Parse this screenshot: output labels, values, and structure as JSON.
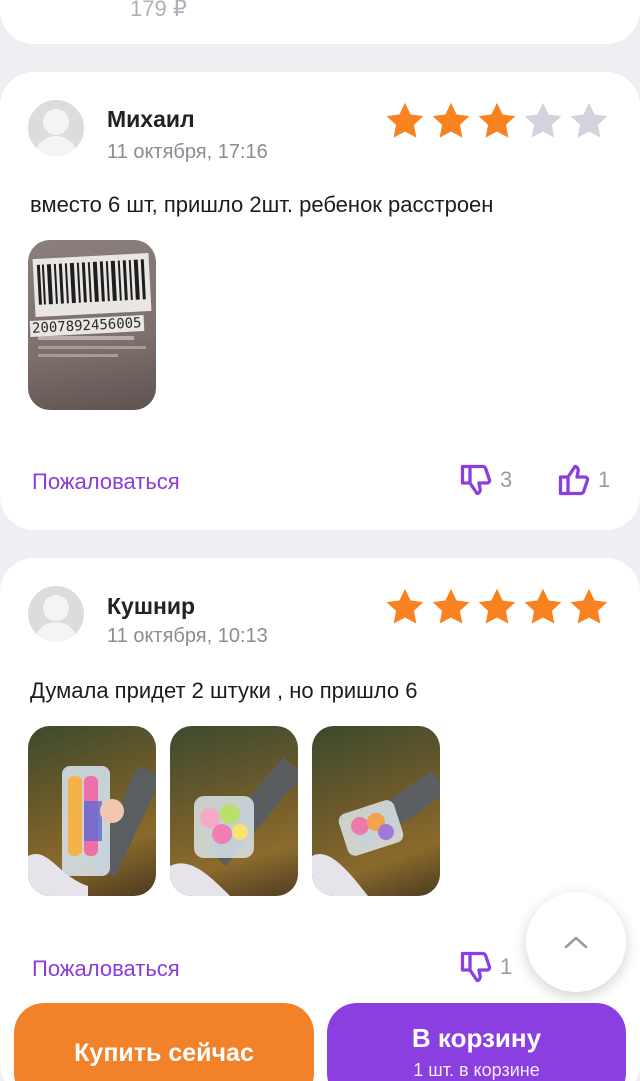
{
  "top_card": {
    "price": "179 ₽"
  },
  "reviews": [
    {
      "author": "Михаил",
      "date": "11 октября, 17:16",
      "rating": 3,
      "max_rating": 5,
      "text": "вместо 6 шт, пришло 2шт. ребенок расстроен",
      "photo_barcode_number": "2007892456005",
      "complain_label": "Пожаловаться",
      "dislikes": "3",
      "likes": "1"
    },
    {
      "author": "Кушнир",
      "date": "11 октября, 10:13",
      "rating": 5,
      "max_rating": 5,
      "text": "Думала придет 2 штуки , но пришло 6",
      "photos_count": 3,
      "complain_label": "Пожаловаться",
      "dislikes": "1"
    }
  ],
  "bottom_bar": {
    "buy_now_label": "Купить сейчас",
    "cart_label": "В корзину",
    "cart_sub_label": "1 шт. в корзине"
  },
  "colors": {
    "accent_purple": "#8b3fe0",
    "accent_orange": "#f2822a",
    "star_filled": "#f7821f",
    "star_empty": "#d3d3de"
  },
  "icons": [
    "avatar-placeholder-icon",
    "star-icon",
    "thumbs-down-icon",
    "thumbs-up-icon",
    "chevron-up-icon"
  ]
}
